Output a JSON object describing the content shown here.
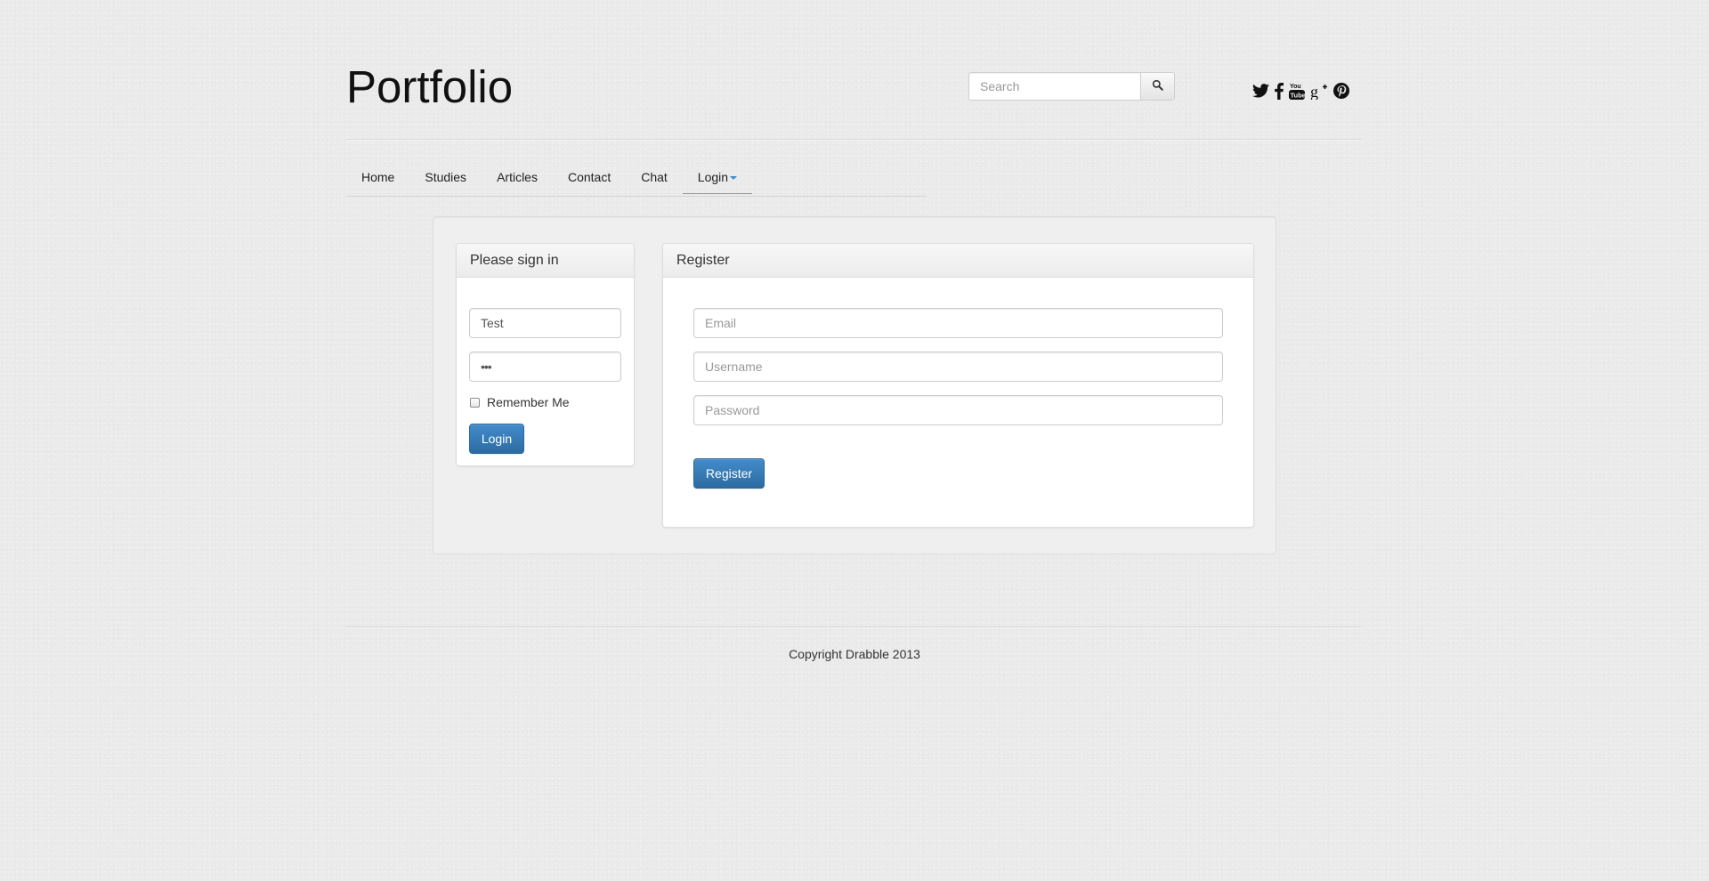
{
  "header": {
    "brand": "Portfolio",
    "search": {
      "placeholder": "Search",
      "value": ""
    },
    "social": [
      {
        "name": "twitter",
        "icon": "twitter-icon"
      },
      {
        "name": "facebook",
        "icon": "facebook-icon"
      },
      {
        "name": "youtube",
        "icon": "youtube-icon"
      },
      {
        "name": "google-plus",
        "icon": "google-plus-icon"
      },
      {
        "name": "pinterest",
        "icon": "pinterest-icon"
      }
    ]
  },
  "nav": {
    "items": [
      {
        "label": "Home"
      },
      {
        "label": "Studies"
      },
      {
        "label": "Articles"
      },
      {
        "label": "Contact"
      },
      {
        "label": "Chat"
      },
      {
        "label": "Login",
        "active": true,
        "dropdown": true
      }
    ]
  },
  "signin": {
    "title": "Please sign in",
    "username_value": "Test",
    "password_value": "•••",
    "remember_label": "Remember Me",
    "remember_checked": false,
    "submit_label": "Login"
  },
  "register": {
    "title": "Register",
    "email_placeholder": "Email",
    "username_placeholder": "Username",
    "password_placeholder": "Password",
    "submit_label": "Register"
  },
  "footer": {
    "copyright": "Copyright Drabble 2013"
  },
  "colors": {
    "primary": "#428bca",
    "background": "#ebebeb"
  }
}
